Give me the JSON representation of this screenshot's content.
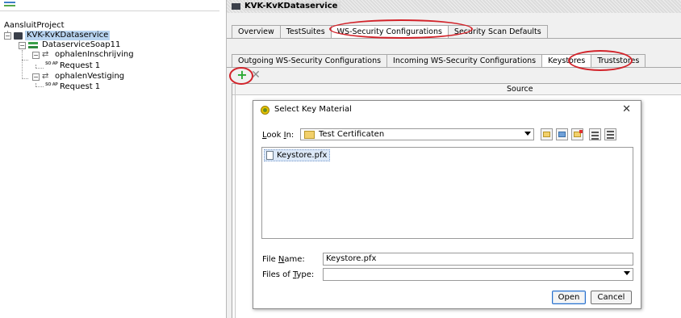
{
  "tree": {
    "project": "AansluitProject",
    "service": "KVK-KvKDataservice",
    "interface": "DataserviceSoap11",
    "operations": [
      {
        "name": "ophalenInschrijving",
        "request": "Request 1"
      },
      {
        "name": "ophalenVestiging",
        "request": "Request 1"
      }
    ],
    "request_icon_text": "SO AP"
  },
  "editor": {
    "title": "KVK-KvKDataservice",
    "tabs": [
      "Overview",
      "TestSuites",
      "WS-Security Configurations",
      "Security Scan Defaults"
    ],
    "active_tab": "WS-Security Configurations",
    "sub_tabs": [
      "Outgoing WS-Security Configurations",
      "Incoming WS-Security Configurations",
      "Keystores",
      "Truststores"
    ],
    "active_sub_tab": "Keystores",
    "table_columns": [
      "Source"
    ],
    "add_label": "+",
    "remove_label": "✕"
  },
  "dialog": {
    "title": "Select Key Material",
    "close": "✕",
    "look_in_label": "Look In:",
    "look_in_value": "Test Certificaten",
    "files": [
      "Keystore.pfx"
    ],
    "file_name_label": "File Name:",
    "file_name_value": "Keystore.pfx",
    "files_of_type_label": "Files of Type:",
    "files_of_type_value": "",
    "open_label": "Open",
    "cancel_label": "Cancel"
  },
  "colors": {
    "annotation": "#d2232a",
    "selection": "#b8d4f0",
    "add_icon": "#2aa832"
  }
}
